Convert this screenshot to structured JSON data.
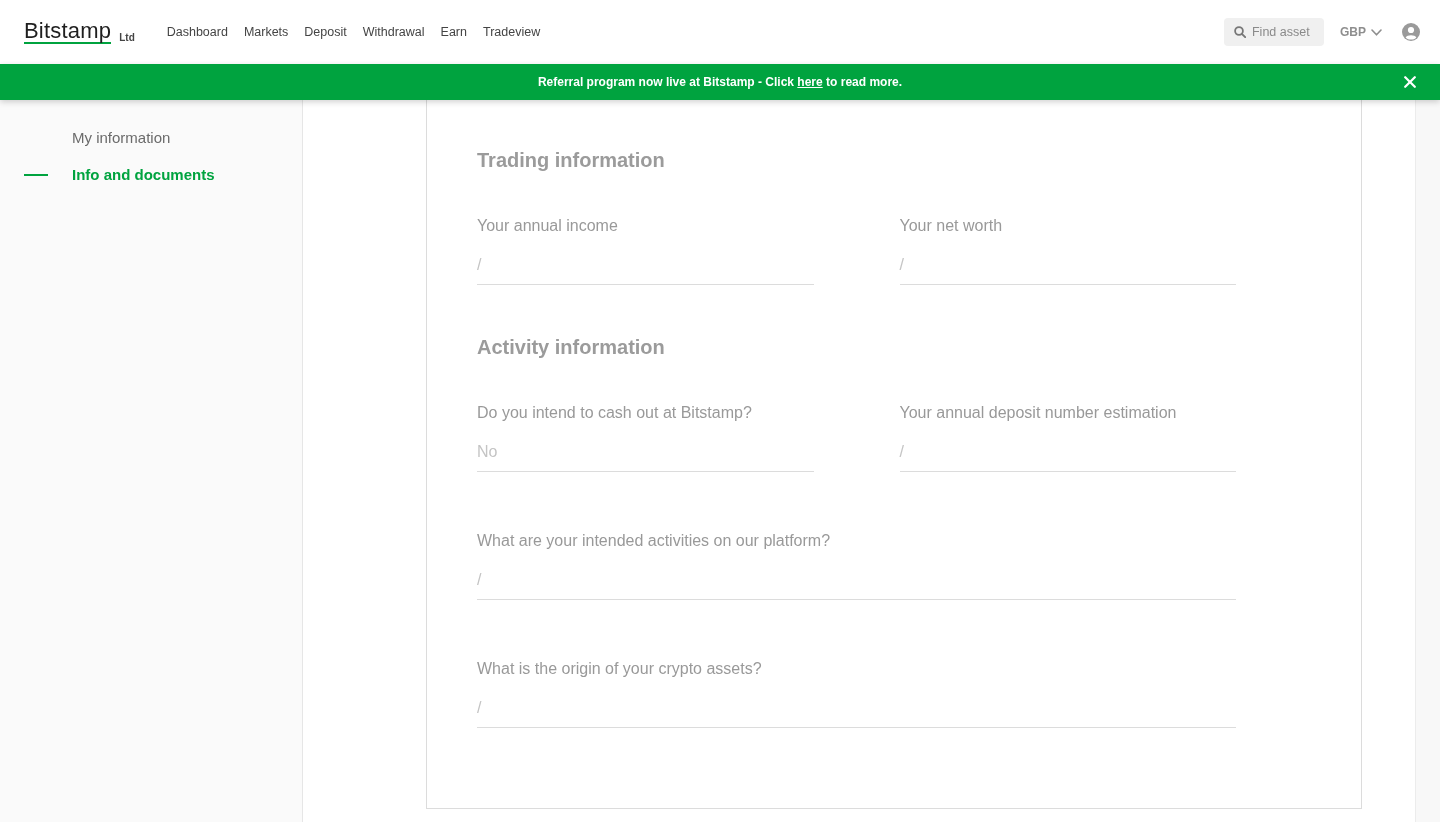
{
  "header": {
    "logo": "Bitstamp",
    "logo_suffix": "Ltd",
    "nav": [
      "Dashboard",
      "Markets",
      "Deposit",
      "Withdrawal",
      "Earn",
      "Tradeview"
    ],
    "search": {
      "placeholder": "Find asset"
    },
    "currency": "GBP"
  },
  "banner": {
    "message_start": "Referral program now live at Bitstamp - Click",
    "link": "here",
    "message_end": "to read more."
  },
  "sidebar": {
    "items": [
      {
        "label": "My information",
        "selected": false
      },
      {
        "label": "Info and documents",
        "selected": true
      }
    ]
  },
  "form": {
    "sections": [
      {
        "title": "Trading information",
        "rows": [
          {
            "fields": [
              {
                "label": "Your annual income",
                "value": "/"
              },
              {
                "label": "Your net worth",
                "value": "/"
              }
            ]
          }
        ]
      },
      {
        "title": "Activity information",
        "rows": [
          {
            "fields": [
              {
                "label": "Do you intend to cash out at Bitstamp?",
                "value": "No"
              },
              {
                "label": "Your annual deposit number estimation",
                "value": "/"
              }
            ]
          },
          {
            "fields": [
              {
                "label": "What are your intended activities on our platform?",
                "value": "/"
              }
            ]
          },
          {
            "fields": [
              {
                "label": "What is the origin of your crypto assets?",
                "value": "/"
              }
            ]
          }
        ]
      }
    ]
  }
}
